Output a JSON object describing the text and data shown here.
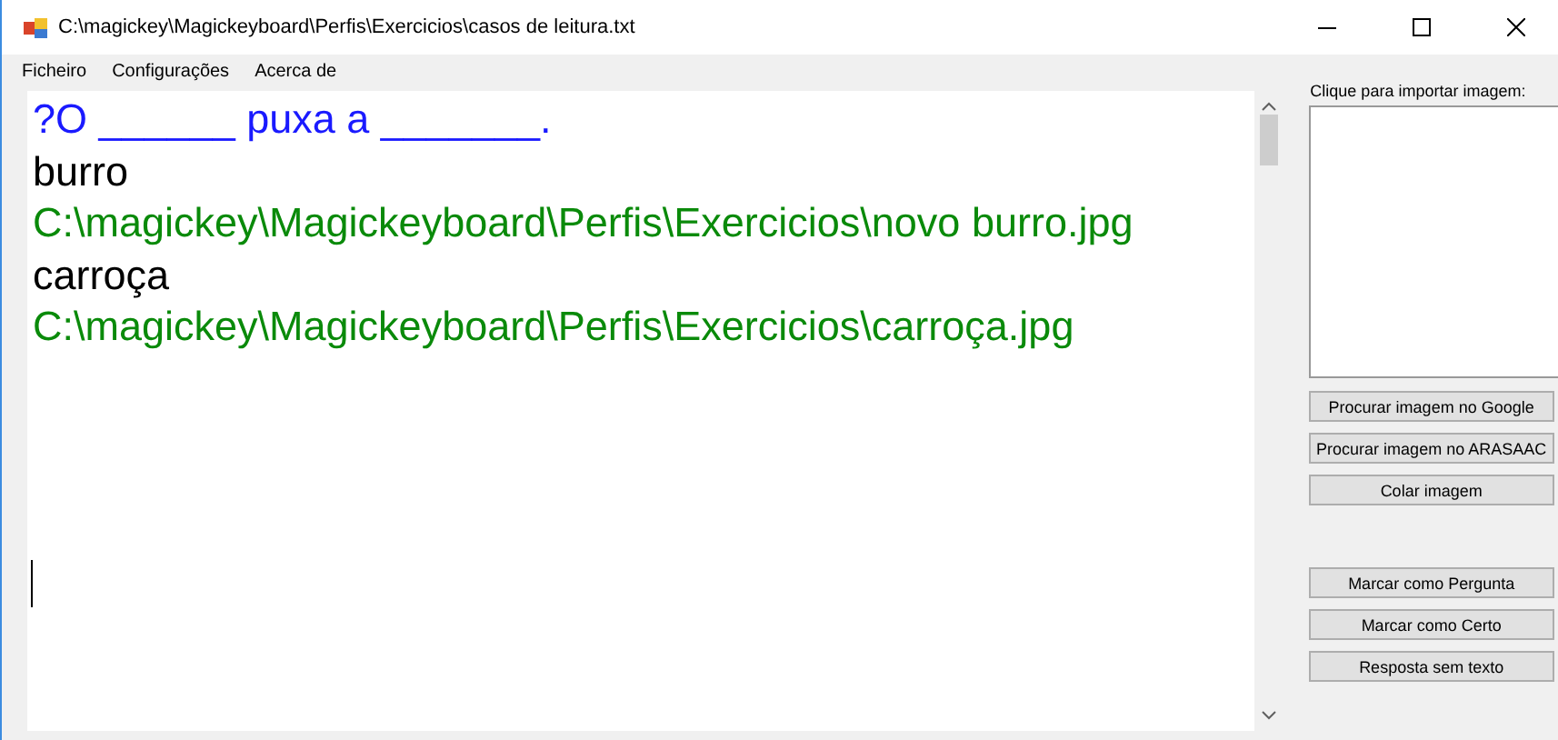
{
  "window": {
    "title": "C:\\magickey\\Magickeyboard\\Perfis\\Exercicios\\casos de leitura.txt"
  },
  "menu": [
    "Ficheiro",
    "Configurações",
    "Acerca de"
  ],
  "editor": {
    "lines": [
      {
        "kind": "question",
        "text": "?O ______ puxa a _______."
      },
      {
        "kind": "word",
        "text": "burro"
      },
      {
        "kind": "path",
        "text": "C:\\magickey\\Magickeyboard\\Perfis\\Exercicios\\novo burro.jpg"
      },
      {
        "kind": "word",
        "text": "carroça"
      },
      {
        "kind": "path",
        "text": "C:\\magickey\\Magickeyboard\\Perfis\\Exercicios\\carroça.jpg"
      }
    ]
  },
  "image_panel": {
    "label": "Clique para importar imagem:"
  },
  "image_buttons": [
    "Procurar imagem no Google",
    "Procurar imagem no ARASAAC",
    "Colar imagem"
  ],
  "mark_buttons": [
    "Marcar como Pergunta",
    "Marcar como Certo",
    "Resposta sem texto"
  ]
}
